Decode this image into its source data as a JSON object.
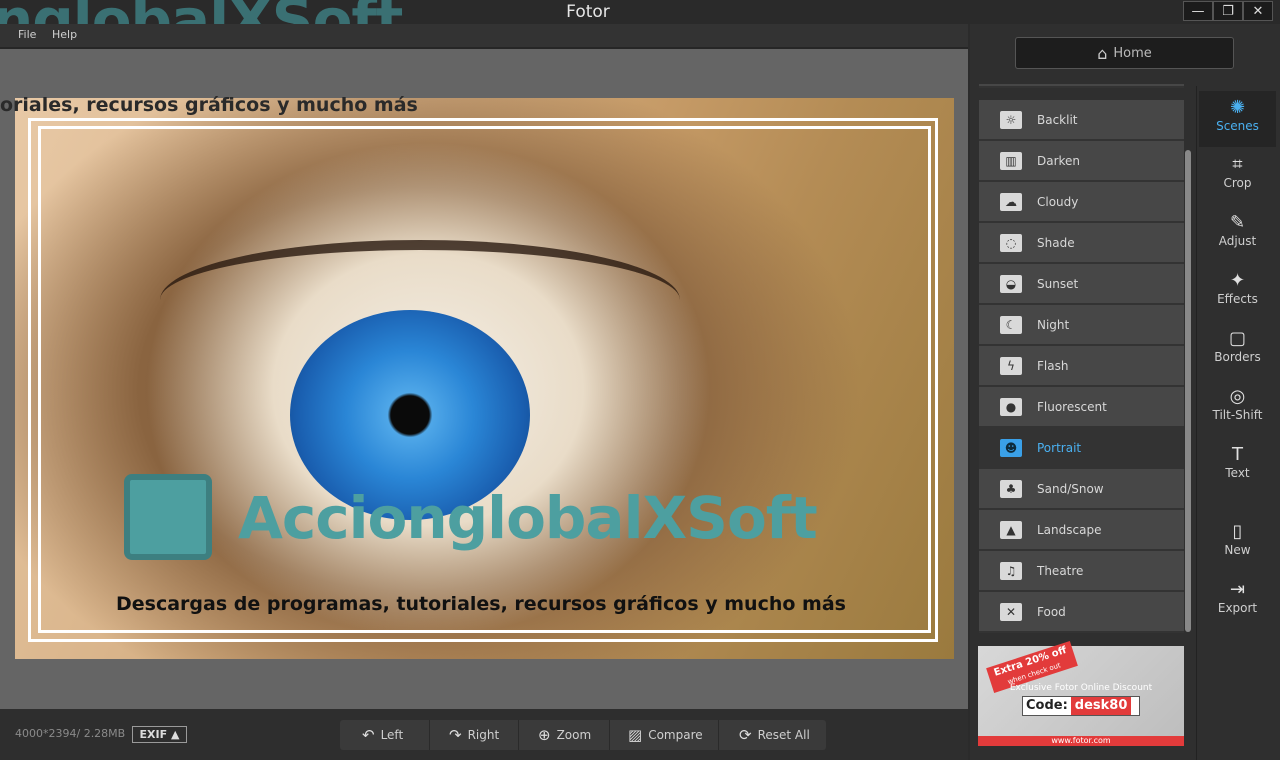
{
  "window": {
    "title": "Fotor",
    "watermark": "nglobalXSoft",
    "controls": {
      "minimize": "—",
      "restore": "❐",
      "close": "✕"
    }
  },
  "menu": {
    "file": "File",
    "help": "Help"
  },
  "canvas": {
    "watermark_strip": "oriales, recursos gráficos y mucho más",
    "brand_title": "AccionglobalXSoft",
    "brand_subtitle": "Descargas de programas, tutoriales, recursos gráficos y mucho más"
  },
  "bottom": {
    "image_info": "4000*2394/ 2.28MB",
    "exif": "EXIF ▲",
    "tools": [
      {
        "label": "Left",
        "icon": "rotate-left-icon",
        "glyph": "↶"
      },
      {
        "label": "Right",
        "icon": "rotate-right-icon",
        "glyph": "↷"
      },
      {
        "label": "Zoom",
        "icon": "zoom-icon",
        "glyph": "⊕"
      },
      {
        "label": "Compare",
        "icon": "compare-icon",
        "glyph": "▨"
      },
      {
        "label": "Reset  All",
        "icon": "reset-icon",
        "glyph": "⟳"
      }
    ]
  },
  "home": {
    "label": "Home",
    "glyph": "⌂"
  },
  "scenes": [
    {
      "label": "Backlit",
      "icon": "backlit-icon",
      "glyph": "☼"
    },
    {
      "label": "Darken",
      "icon": "darken-icon",
      "glyph": "▥"
    },
    {
      "label": "Cloudy",
      "icon": "cloudy-icon",
      "glyph": "☁"
    },
    {
      "label": "Shade",
      "icon": "shade-icon",
      "glyph": "◌"
    },
    {
      "label": "Sunset",
      "icon": "sunset-icon",
      "glyph": "◒"
    },
    {
      "label": "Night",
      "icon": "night-icon",
      "glyph": "☾"
    },
    {
      "label": "Flash",
      "icon": "flash-icon",
      "glyph": "ϟ"
    },
    {
      "label": "Fluorescent",
      "icon": "fluorescent-icon",
      "glyph": "●"
    },
    {
      "label": "Portrait",
      "icon": "portrait-icon",
      "glyph": "☻",
      "active": true
    },
    {
      "label": "Sand/Snow",
      "icon": "sand-snow-icon",
      "glyph": "♣"
    },
    {
      "label": "Landscape",
      "icon": "landscape-icon",
      "glyph": "▲"
    },
    {
      "label": "Theatre",
      "icon": "theatre-icon",
      "glyph": "♫"
    },
    {
      "label": "Food",
      "icon": "food-icon",
      "glyph": "✕"
    }
  ],
  "ad": {
    "ribbon": "Extra 20% off",
    "ribbon_sub": "when check out",
    "line": "Exclusive Fotor Online Discount",
    "code_label": "Code:",
    "code_value": "desk80",
    "url": "www.fotor.com"
  },
  "rail": [
    {
      "label": "Scenes",
      "icon": "scenes-icon",
      "glyph": "✺",
      "active": true
    },
    {
      "label": "Crop",
      "icon": "crop-icon",
      "glyph": "⌗"
    },
    {
      "label": "Adjust",
      "icon": "adjust-icon",
      "glyph": "✎"
    },
    {
      "label": "Effects",
      "icon": "effects-icon",
      "glyph": "✦"
    },
    {
      "label": "Borders",
      "icon": "borders-icon",
      "glyph": "▢"
    },
    {
      "label": "Tilt-Shift",
      "icon": "tilt-shift-icon",
      "glyph": "◎"
    },
    {
      "label": "Text",
      "icon": "text-icon",
      "glyph": "T"
    },
    {
      "label": "New",
      "icon": "new-icon",
      "glyph": "▯"
    },
    {
      "label": "Export",
      "icon": "export-icon",
      "glyph": "⇥"
    }
  ],
  "colors": {
    "accent": "#4ab0f0",
    "brand": "#4d9fa0",
    "ad_red": "#e23b3b"
  }
}
